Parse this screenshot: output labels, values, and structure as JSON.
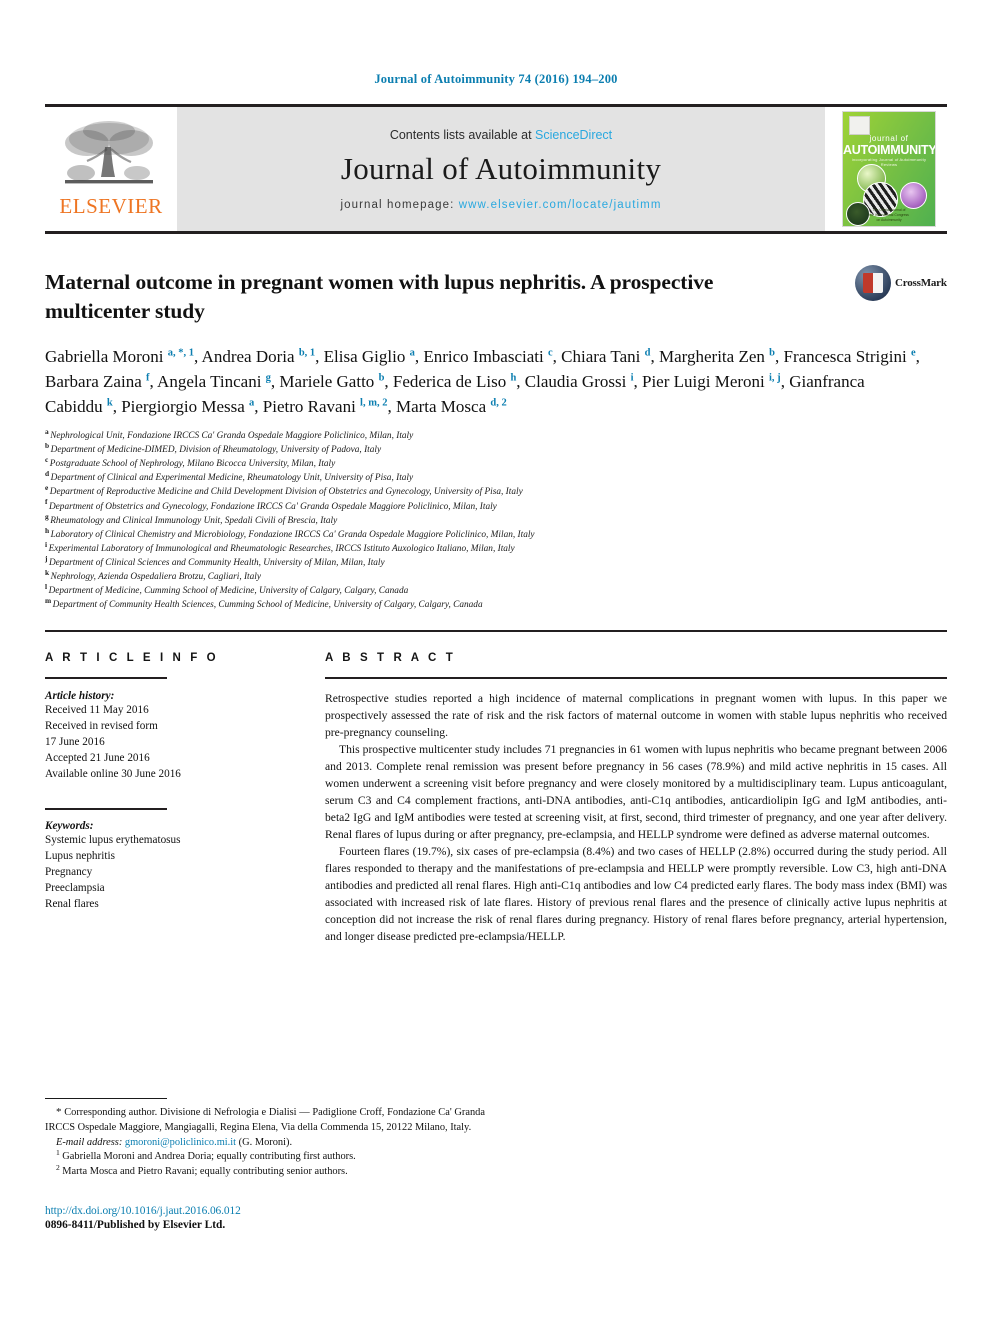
{
  "running_head": "Journal of Autoimmunity 74 (2016) 194–200",
  "masthead": {
    "contents_prefix": "Contents lists available at ",
    "sciencedirect": "ScienceDirect",
    "journal_name": "Journal of Autoimmunity",
    "homepage_prefix": "journal homepage: ",
    "homepage_url": "www.elsevier.com/locate/jautimm",
    "publisher_logo_text": "ELSEVIER",
    "cover": {
      "line_journal": "journal of",
      "line_title": "AUTOIMMUNITY",
      "line_sub": "incorporating Journal of Autoimmunity Reviews",
      "footer": "The Official Journal of\nthe International Congress\non Autoimmunity"
    }
  },
  "article": {
    "title": "Maternal outcome in pregnant women with lupus nephritis. A prospective multicenter study",
    "crossmark_label": "CrossMark"
  },
  "authors_html": "Gabriella Moroni <sup>a, *, 1</sup>, Andrea Doria <sup>b, 1</sup>, Elisa Giglio <sup>a</sup>, Enrico Imbasciati <sup>c</sup>, Chiara Tani <sup>d</sup>, Margherita Zen <sup>b</sup>, Francesca Strigini <sup>e</sup>, Barbara Zaina <sup>f</sup>, Angela Tincani <sup>g</sup>, Mariele Gatto <sup>b</sup>, Federica de Liso <sup>h</sup>, Claudia Grossi <sup>i</sup>, Pier Luigi Meroni <sup>i, j</sup>, Gianfranca Cabiddu <sup>k</sup>, Piergiorgio Messa <sup>a</sup>, Pietro Ravani <sup>l, m, 2</sup>, Marta Mosca <sup>d, 2</sup>",
  "affiliations": [
    {
      "marker": "a",
      "text": "Nephrological Unit, Fondazione IRCCS Ca' Granda Ospedale Maggiore Policlinico, Milan, Italy"
    },
    {
      "marker": "b",
      "text": "Department of Medicine-DIMED, Division of Rheumatology, University of Padova, Italy"
    },
    {
      "marker": "c",
      "text": "Postgraduate School of Nephrology, Milano Bicocca University, Milan, Italy"
    },
    {
      "marker": "d",
      "text": "Department of Clinical and Experimental Medicine, Rheumatology Unit, University of Pisa, Italy"
    },
    {
      "marker": "e",
      "text": "Department of Reproductive Medicine and Child Development Division of Obstetrics and Gynecology, University of Pisa, Italy"
    },
    {
      "marker": "f",
      "text": "Department of Obstetrics and Gynecology, Fondazione IRCCS Ca' Granda Ospedale Maggiore Policlinico, Milan, Italy"
    },
    {
      "marker": "g",
      "text": "Rheumatology and Clinical Immunology Unit, Spedali Civili of Brescia, Italy"
    },
    {
      "marker": "h",
      "text": "Laboratory of Clinical Chemistry and Microbiology, Fondazione IRCCS Ca' Granda Ospedale Maggiore Policlinico, Milan, Italy"
    },
    {
      "marker": "i",
      "text": "Experimental Laboratory of Immunological and Rheumatologic Researches, IRCCS Istituto Auxologico Italiano, Milan, Italy"
    },
    {
      "marker": "j",
      "text": "Department of Clinical Sciences and Community Health, University of Milan, Milan, Italy"
    },
    {
      "marker": "k",
      "text": "Nephrology, Azienda Ospedaliera Brotzu, Cagliari, Italy"
    },
    {
      "marker": "l",
      "text": "Department of Medicine, Cumming School of Medicine, University of Calgary, Calgary, Canada"
    },
    {
      "marker": "m",
      "text": "Department of Community Health Sciences, Cumming School of Medicine, University of Calgary, Calgary, Canada"
    }
  ],
  "article_info": {
    "heading": "A R T I C L E  I N F O",
    "history_label": "Article history:",
    "history": [
      "Received 11 May 2016",
      "Received in revised form",
      "17 June 2016",
      "Accepted 21 June 2016",
      "Available online 30 June 2016"
    ],
    "keywords_label": "Keywords:",
    "keywords": [
      "Systemic lupus erythematosus",
      "Lupus nephritis",
      "Pregnancy",
      "Preeclampsia",
      "Renal flares"
    ]
  },
  "abstract": {
    "heading": "A B S T R A C T",
    "paragraphs": [
      "Retrospective studies reported a high incidence of maternal complications in pregnant women with lupus. In this paper we prospectively assessed the rate of risk and the risk factors of maternal outcome in women with stable lupus nephritis who received pre-pregnancy counseling.",
      "This prospective multicenter study includes 71 pregnancies in 61 women with lupus nephritis who became pregnant between 2006 and 2013. Complete renal remission was present before pregnancy in 56 cases (78.9%) and mild active nephritis in 15 cases. All women underwent a screening visit before pregnancy and were closely monitored by a multidisciplinary team. Lupus anticoagulant, serum C3 and C4 complement fractions, anti-DNA antibodies, anti-C1q antibodies, anticardiolipin IgG and IgM antibodies, anti-beta2 IgG and IgM antibodies were tested at screening visit, at first, second, third trimester of pregnancy, and one year after delivery. Renal flares of lupus during or after pregnancy, pre-eclampsia, and HELLP syndrome were defined as adverse maternal outcomes.",
      "Fourteen flares (19.7%), six cases of pre-eclampsia (8.4%) and two cases of HELLP (2.8%) occurred during the study period. All flares responded to therapy and the manifestations of pre-eclampsia and HELLP were promptly reversible. Low C3, high anti-DNA antibodies and predicted all renal flares. High anti-C1q antibodies and low C4 predicted early flares. The body mass index (BMI) was associated with increased risk of late flares. History of previous renal flares and the presence of clinically active lupus nephritis at conception did not increase the risk of renal flares during pregnancy. History of renal flares before pregnancy, arterial hypertension, and longer disease predicted pre-eclampsia/HELLP."
    ]
  },
  "footnotes": {
    "corresponding": "Corresponding author. Divisione di Nefrologia e Dialisi — Padiglione Croff, Fondazione Ca' Granda IRCCS Ospedale Maggiore, Mangiagalli, Regina Elena, Via della Commenda 15, 20122 Milano, Italy.",
    "email_label": "E-mail address:",
    "email": "gmoroni@policlinico.mi.it",
    "email_suffix": "(G. Moroni).",
    "note1_marker": "1",
    "note1": "Gabriella Moroni and Andrea Doria; equally contributing first authors.",
    "note2_marker": "2",
    "note2": "Marta Mosca and Pietro Ravani; equally contributing senior authors."
  },
  "footer": {
    "doi": "http://dx.doi.org/10.1016/j.jaut.2016.06.012",
    "issn_line": "0896-8411/Published by Elsevier Ltd."
  },
  "colors": {
    "link_blue": "#0b7eb0",
    "sciencedirect_blue": "#29a8df",
    "elsevier_orange": "#ee7523",
    "rule_black": "#231f20",
    "masthead_gray": "#e3e3e3"
  }
}
